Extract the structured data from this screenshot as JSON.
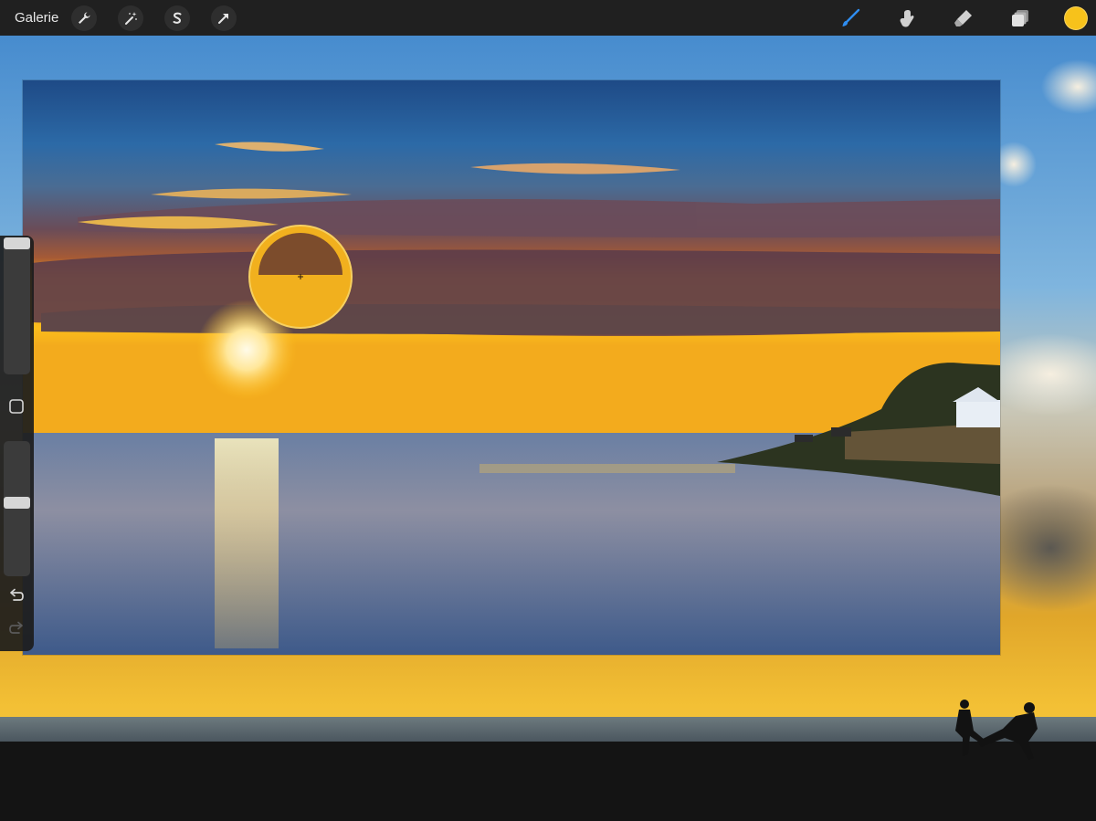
{
  "toolbar": {
    "gallery_label": "Galerie",
    "left_tools": [
      "wrench-icon",
      "magic-wand-icon",
      "selection-s-icon",
      "transform-arrow-icon"
    ],
    "right_tools": [
      "brush-icon",
      "smudge-icon",
      "eraser-icon",
      "layers-icon"
    ],
    "active_tool": "brush",
    "current_color": "#F7C21B"
  },
  "sidebar": {
    "brush_size_level": 0.0,
    "opacity_level": 0.45,
    "controls": [
      "modify-square-icon",
      "undo-icon",
      "redo-icon"
    ]
  },
  "eyedropper": {
    "upper_color": "#7C4C2C",
    "lower_color": "#F1B01E"
  },
  "colors": {
    "toolbar_bg": "#202020",
    "brush_active": "#2F8DF0",
    "icon_gray": "#D0D0D0"
  }
}
